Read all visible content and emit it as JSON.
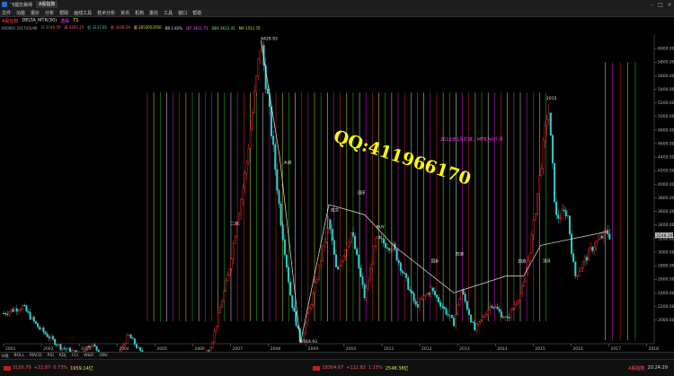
{
  "window": {
    "title": "飞狐交易师",
    "tab": "A股指数",
    "controls": [
      "–",
      "□",
      "×"
    ]
  },
  "menu": [
    "文件",
    "功能",
    "报价",
    "分析",
    "帮助",
    "画线工具",
    "技术分析",
    "资讯",
    "机构",
    "委托",
    "工具",
    "窗口",
    "帮助"
  ],
  "info": {
    "line1": [
      "A股指数",
      "DELTA_MTR(30)",
      "选股",
      "T1"
    ],
    "line2": [
      "000001 2017/01/06",
      "开 3249.50",
      "高 3261.25",
      "低 3237.85",
      "收 3248.29",
      "量 2053052050",
      "BB 1.82%",
      "DIF 3611.73",
      "DEA 3612.45",
      "MA 1511.70"
    ],
    "price_color": "#ffff00"
  },
  "chart_data": {
    "type": "candlestick",
    "x_ticks": [
      "2001",
      "2002",
      "2003",
      "2004",
      "2005",
      "2006",
      "2007",
      "2008",
      "2009",
      "2010",
      "2011",
      "2012",
      "2013",
      "2014",
      "2015",
      "2016",
      "2017",
      "2018"
    ],
    "y_ticks": [
      2000,
      2200,
      2400,
      2600,
      2800,
      3000,
      3200,
      3400,
      3600,
      3800,
      4000,
      4200,
      4400,
      4600,
      4800,
      5000,
      5200,
      5400,
      5600,
      5800,
      6000
    ],
    "ylim": [
      1650,
      6200
    ],
    "xlim": [
      2001.0,
      2018.2
    ],
    "current_price": 3248.29,
    "anchors": [
      [
        2001.0,
        2100
      ],
      [
        2001.5,
        2200
      ],
      [
        2001.9,
        1900
      ],
      [
        2002.5,
        1600
      ],
      [
        2003.0,
        1500
      ],
      [
        2003.3,
        1650
      ],
      [
        2003.9,
        1350
      ],
      [
        2004.3,
        1780
      ],
      [
        2004.9,
        1300
      ],
      [
        2005.5,
        1000
      ],
      [
        2005.9,
        1120
      ],
      [
        2006.5,
        1650
      ],
      [
        2006.95,
        2700
      ],
      [
        2007.4,
        4200
      ],
      [
        2007.8,
        6124
      ],
      [
        2008.0,
        5200
      ],
      [
        2008.3,
        3600
      ],
      [
        2008.6,
        2300
      ],
      [
        2008.85,
        1664
      ],
      [
        2009.2,
        2400
      ],
      [
        2009.6,
        3478
      ],
      [
        2009.8,
        2700
      ],
      [
        2010.2,
        3300
      ],
      [
        2010.55,
        2320
      ],
      [
        2010.85,
        3186
      ],
      [
        2011.3,
        3067
      ],
      [
        2011.9,
        2200
      ],
      [
        2012.3,
        2450
      ],
      [
        2012.9,
        1949
      ],
      [
        2013.1,
        2444
      ],
      [
        2013.45,
        1849
      ],
      [
        2013.9,
        2240
      ],
      [
        2014.3,
        2000
      ],
      [
        2014.75,
        2500
      ],
      [
        2015.0,
        3350
      ],
      [
        2015.4,
        5178
      ],
      [
        2015.6,
        3500
      ],
      [
        2015.9,
        3600
      ],
      [
        2016.1,
        2638
      ],
      [
        2016.6,
        3100
      ],
      [
        2016.95,
        3301
      ],
      [
        2017.02,
        3248
      ]
    ],
    "annotations": [
      {
        "text": "6429.93",
        "x": 2007.8,
        "y": 6124
      },
      {
        "text": "998.23",
        "x": 2005.5,
        "y": 1000
      },
      {
        "text": "1664.93",
        "x": 2008.85,
        "y": 1664
      },
      {
        "text": "二浪",
        "x": 2007.0,
        "y": 3400
      },
      {
        "text": "大浪",
        "x": 2008.4,
        "y": 4300
      },
      {
        "text": "成交",
        "x": 2009.65,
        "y": 3600
      },
      {
        "text": "顶环",
        "x": 2010.35,
        "y": 3850
      },
      {
        "text": "BUY",
        "x": 2010.85,
        "y": 3350
      },
      {
        "text": "回补",
        "x": 2012.3,
        "y": 2850
      },
      {
        "text": "四浪",
        "x": 2012.95,
        "y": 2950
      },
      {
        "text": "四浪",
        "x": 2014.6,
        "y": 2850
      },
      {
        "text": "顶环",
        "x": 2015.25,
        "y": 2850
      },
      {
        "text": "2015",
        "x": 2015.35,
        "y": 5250
      }
    ],
    "wave_lines": [
      [
        [
          2008.85,
          1664
        ],
        [
          2009.6,
          3700
        ],
        [
          2010.55,
          3550
        ],
        [
          2011.3,
          3100
        ],
        [
          2012.9,
          2400
        ],
        [
          2014.3,
          2650
        ],
        [
          2014.75,
          2650
        ],
        [
          2015.2,
          3100
        ],
        [
          2016.95,
          3301
        ]
      ]
    ],
    "vertical_lines": {
      "colors": [
        "#d03030",
        "#e0e040",
        "#30c030",
        "#e0e0e0",
        "#d020d0"
      ]
    },
    "watermark": "QQ:411966170",
    "note": "2016年1月打底，MTR为0个月",
    "colors": {
      "up": "#ff3030",
      "down": "#30d0d0",
      "bg": "#000000",
      "grid": "#444444"
    }
  },
  "bottom_tabs": [
    "K线",
    "BOLL",
    "MACD",
    "RSI",
    "KDJ",
    "CCI",
    "W&R",
    "OBV"
  ],
  "status": {
    "left": [
      "3150.79",
      "+22.87",
      "0.73%",
      "1959.14亿"
    ],
    "mid": [
      "18304.67",
      "+122.82",
      "1.15%",
      "2548.38亿"
    ],
    "right": [
      "A股指数",
      "20:24:29"
    ]
  }
}
